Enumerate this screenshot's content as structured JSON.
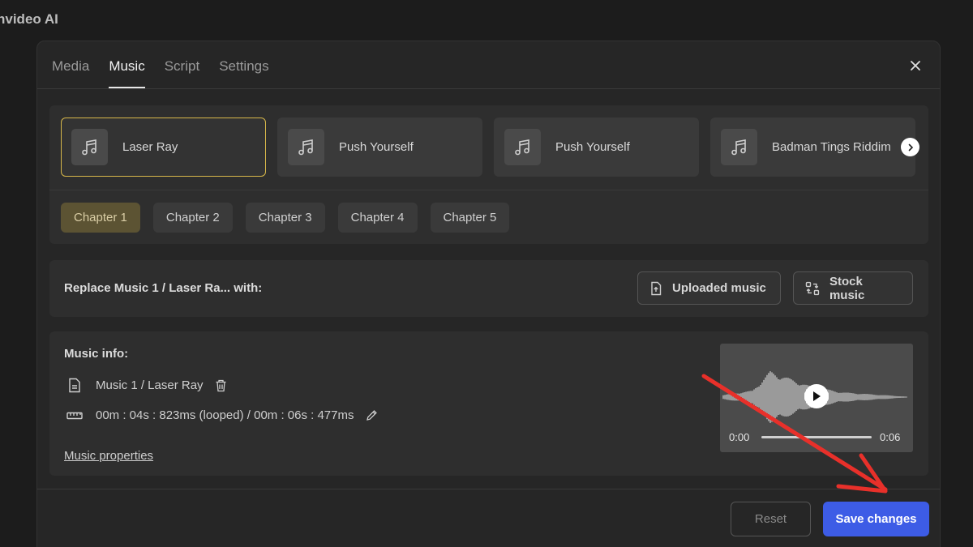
{
  "app": {
    "title": "nvideo AI"
  },
  "tabs": [
    {
      "label": "Media"
    },
    {
      "label": "Music"
    },
    {
      "label": "Script"
    },
    {
      "label": "Settings"
    }
  ],
  "active_tab": "Music",
  "tracks": [
    {
      "name": "Laser Ray",
      "selected": true,
      "icon": "music-note-icon"
    },
    {
      "name": "Push Yourself",
      "selected": false,
      "icon": "music-note-icon"
    },
    {
      "name": "Push Yourself",
      "selected": false,
      "icon": "music-note-icon"
    },
    {
      "name": "Badman Tings Riddim",
      "selected": false,
      "icon": "music-note-icon"
    }
  ],
  "chapters": [
    {
      "label": "Chapter 1",
      "active": true
    },
    {
      "label": "Chapter 2",
      "active": false
    },
    {
      "label": "Chapter 3",
      "active": false
    },
    {
      "label": "Chapter 4",
      "active": false
    },
    {
      "label": "Chapter 5",
      "active": false
    }
  ],
  "replace": {
    "label": "Replace Music 1 / Laser Ra... with:",
    "uploaded_label": "Uploaded music",
    "stock_label": "Stock music"
  },
  "music_info": {
    "title": "Music info:",
    "file_name": "Music 1 / Laser Ray",
    "duration": "00m : 04s : 823ms (looped) / 00m : 06s : 477ms",
    "properties_link": "Music properties"
  },
  "player": {
    "current_time": "0:00",
    "total_time": "0:06",
    "progress": 0
  },
  "footer": {
    "reset_label": "Reset",
    "save_label": "Save changes"
  },
  "colors": {
    "accent": "#3d5ce6",
    "selected_border": "#d8b84a",
    "annotation_arrow": "#e8302a"
  }
}
